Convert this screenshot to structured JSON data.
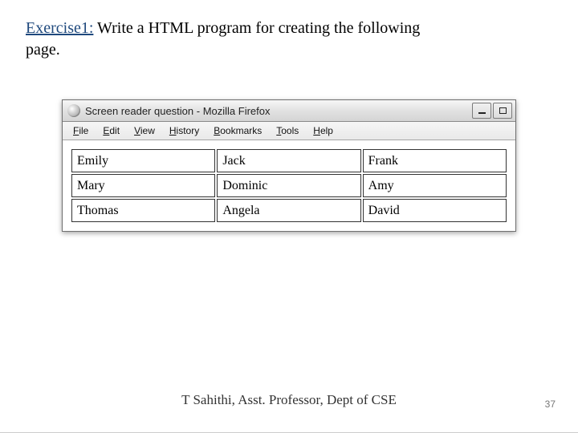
{
  "heading": {
    "label": "Exercise1:",
    "text": "Write a HTML program for creating the following",
    "line2": "page."
  },
  "window": {
    "title": "Screen reader question - Mozilla Firefox"
  },
  "menu": {
    "file": "File",
    "edit": "Edit",
    "view": "View",
    "history": "History",
    "bookmarks": "Bookmarks",
    "tools": "Tools",
    "help": "Help"
  },
  "table": {
    "r0c0": "Emily",
    "r0c1": "Jack",
    "r0c2": "Frank",
    "r1c0": "Mary",
    "r1c1": "Dominic",
    "r1c2": "Amy",
    "r2c0": "Thomas",
    "r2c1": "Angela",
    "r2c2": "David"
  },
  "footer": {
    "credit": "T Sahithi, Asst. Professor, Dept of CSE",
    "page": "37"
  }
}
